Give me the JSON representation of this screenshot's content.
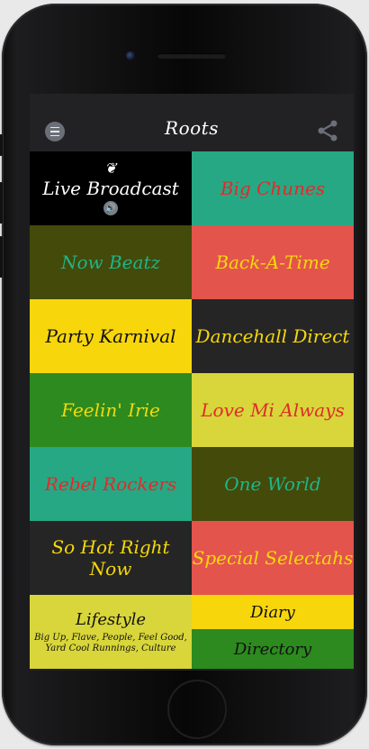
{
  "app": {
    "title": "Roots"
  },
  "icons": {
    "menu": "hamburger-menu-icon",
    "share": "share-icon",
    "live_logo": "leaf-logo-icon",
    "sound": "speaker-volume-icon"
  },
  "tiles": [
    {
      "label": "Live Broadcast",
      "bg": "#000000",
      "color": "#ffffff"
    },
    {
      "label": "Big Chunes",
      "bg": "#27a884",
      "color": "#e02b2b"
    },
    {
      "label": "Now Beatz",
      "bg": "#434a0a",
      "color": "#1fb58a"
    },
    {
      "label": "Back-A-Time",
      "bg": "#e3544d",
      "color": "#f5d90a"
    },
    {
      "label": "Party Karnival",
      "bg": "#f7d60c",
      "color": "#111111"
    },
    {
      "label": "Dancehall Direct",
      "bg": "#252525",
      "color": "#f5d90a"
    },
    {
      "label": "Feelin' Irie",
      "bg": "#2c8a1f",
      "color": "#f5d90a"
    },
    {
      "label": "Love Mi Always",
      "bg": "#d8d63a",
      "color": "#e02b2b"
    },
    {
      "label": "Rebel Rockers",
      "bg": "#27a884",
      "color": "#e02b2b"
    },
    {
      "label": "One World",
      "bg": "#434a0a",
      "color": "#1fb58a"
    },
    {
      "label": "So Hot Right Now",
      "bg": "#252525",
      "color": "#f5d90a"
    },
    {
      "label": "Special Selectahs",
      "bg": "#e3544d",
      "color": "#f5d90a"
    }
  ],
  "lifestyle": {
    "title": "Lifestyle",
    "subtitle": "Big Up, Flave, People, Feel Good, Yard Cool Runnings, Culture"
  },
  "diary": {
    "label": "Diary"
  },
  "directory": {
    "label": "Directory"
  }
}
